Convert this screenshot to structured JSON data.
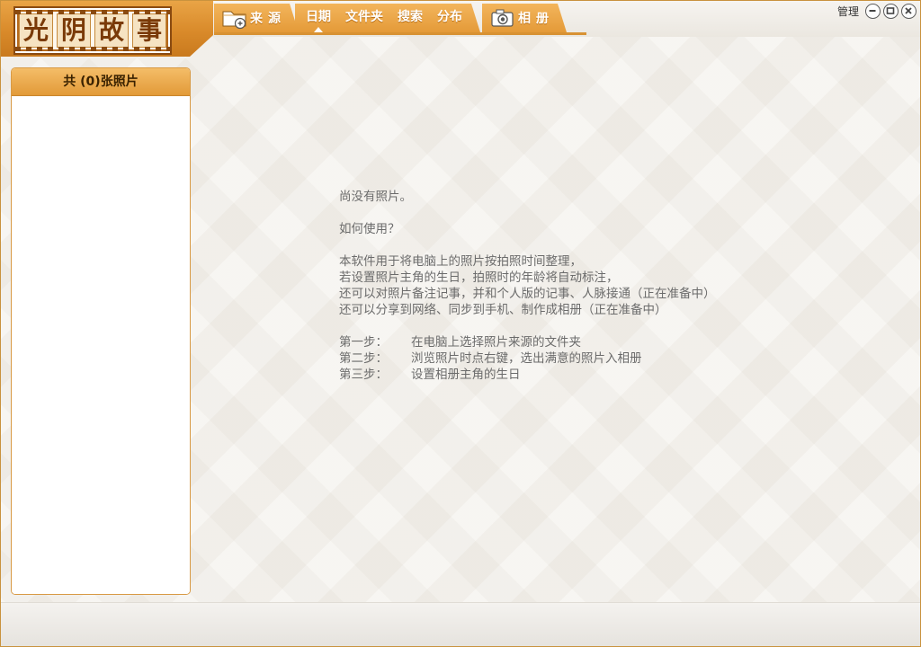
{
  "logo": {
    "chars": [
      "光",
      "阴",
      "故",
      "事"
    ]
  },
  "tabs": {
    "source_label": "来源",
    "sub_tabs": [
      "日期",
      "文件夹",
      "搜索",
      "分布"
    ],
    "album_label": "相册"
  },
  "window_controls": {
    "manage_label": "管理"
  },
  "sidebar": {
    "header": "共 (0)张照片"
  },
  "main": {
    "empty_title": "尚没有照片。",
    "howto_title": "如何使用？",
    "description_lines": [
      "本软件用于将电脑上的照片按拍照时间整理，",
      "若设置照片主角的生日，拍照时的年龄将自动标注，",
      "还可以对照片备注记事，并和个人版的记事、人脉接通（正在准备中）",
      "还可以分享到网络、同步到手机、制作成相册（正在准备中）"
    ],
    "steps": [
      {
        "label": "第一步：",
        "text": "在电脑上选择照片来源的文件夹"
      },
      {
        "label": "第二步：",
        "text": "浏览照片时点右键，选出满意的照片入相册"
      },
      {
        "label": "第三步：",
        "text": "设置相册主角的生日"
      }
    ]
  },
  "colors": {
    "accent_orange": "#e49a38",
    "logo_brown": "#7a3a08",
    "text_gray": "#6b6b6b"
  },
  "icons": {
    "source": "folder-add-icon",
    "album": "camera-icon",
    "minimize": "minimize-icon",
    "restore": "restore-icon",
    "close": "close-icon"
  }
}
